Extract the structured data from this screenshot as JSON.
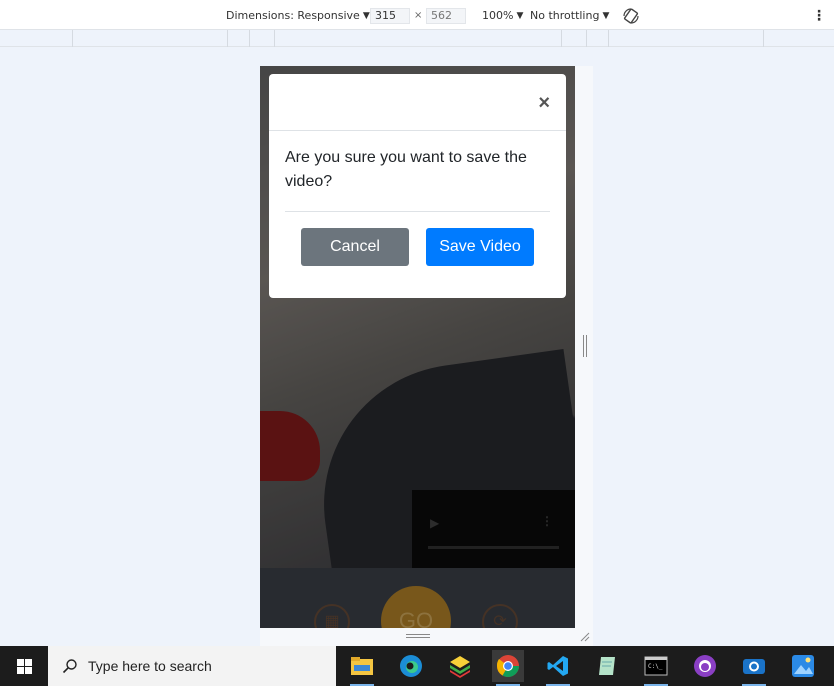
{
  "devtools": {
    "dimensions_label": "Dimensions: Responsive",
    "width": "315",
    "times": "×",
    "height": "562",
    "zoom": "100%",
    "throttling": "No throttling",
    "more": "⋮"
  },
  "device": {
    "go_label": "GO"
  },
  "modal": {
    "close": "×",
    "message": "Are you sure you want to save the video?",
    "cancel_label": "Cancel",
    "save_label": "Save Video"
  },
  "taskbar": {
    "search_placeholder": "Type here to search",
    "apps": [
      "file-explorer",
      "edge",
      "bluestacks",
      "chrome",
      "vscode",
      "notepad-plus",
      "terminal",
      "github-desktop",
      "camera",
      "photos"
    ]
  },
  "colors": {
    "cancel": "#6c757d",
    "save": "#007bff",
    "taskbar": "#1c1c1c"
  }
}
